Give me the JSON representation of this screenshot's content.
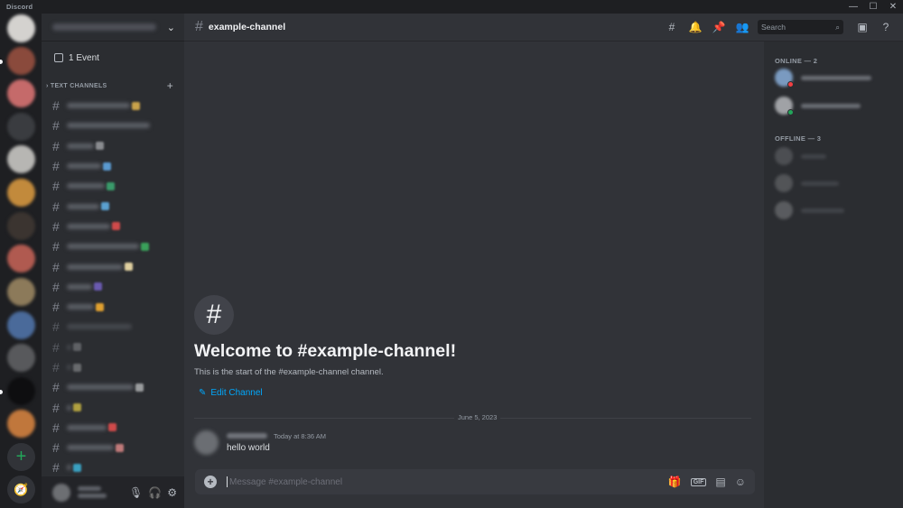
{
  "app": {
    "title": "Discord"
  },
  "window_controls": {
    "minimize": "—",
    "maximize": "☐",
    "close": "✕"
  },
  "guilds": [
    {
      "color": "#d4d2cf",
      "selected": true
    },
    {
      "color": "#8a4a3c"
    },
    {
      "color": "#c56a6a"
    },
    {
      "color": "#3a3c40"
    },
    {
      "color": "#b7b6b3"
    },
    {
      "color": "#c28a3c"
    },
    {
      "color": "#3b3430"
    },
    {
      "color": "#b05a50"
    },
    {
      "color": "#8c7a5a"
    },
    {
      "color": "#4a6a9a"
    },
    {
      "color": "#58595c"
    },
    {
      "color": "#0e0e10"
    },
    {
      "color": "#c0773c"
    }
  ],
  "sidebar": {
    "events_label": "1 Event",
    "category": "TEXT CHANNELS",
    "channels": [
      {
        "emoji": "#c9a24a"
      },
      {
        "emoji": ""
      },
      {
        "emoji": "#8a8c90"
      },
      {
        "emoji": "#5a9ad0"
      },
      {
        "emoji": "#3a9a6a"
      },
      {
        "emoji": "#5aa0d0"
      },
      {
        "emoji": "#d04a4a"
      },
      {
        "emoji": "#3aa05a"
      },
      {
        "emoji": "#e0d0a0"
      },
      {
        "emoji": "#6a5ab0"
      },
      {
        "emoji": "#e0a030"
      },
      {
        "emoji": ""
      },
      {
        "emoji": "#8a8c90"
      },
      {
        "emoji": "#9a9c9e"
      },
      {
        "emoji": "#9a9c9e"
      },
      {
        "emoji": "#b0a040"
      },
      {
        "emoji": "#d04a4a"
      },
      {
        "emoji": "#c07a7a"
      },
      {
        "emoji": "#3aa0c0"
      }
    ]
  },
  "header": {
    "channel_name": "example-channel",
    "search_placeholder": "Search",
    "icons": [
      "threads-icon",
      "bell-icon",
      "pin-icon",
      "members-icon",
      "inbox-icon",
      "help-icon"
    ]
  },
  "chat": {
    "welcome_title": "Welcome to #example-channel!",
    "welcome_subtitle": "This is the start of the #example-channel channel.",
    "edit_channel": "Edit Channel",
    "date_divider": "June 5, 2023",
    "message": {
      "time": "Today at 8:36 AM",
      "text": "hello world"
    },
    "composer_placeholder": "Message #example-channel"
  },
  "members": {
    "online_header": "ONLINE — 2",
    "offline_header": "OFFLINE — 3"
  },
  "colors": {
    "accent": "#00a8fc",
    "online": "#23a55a",
    "dnd": "#f23f43"
  }
}
